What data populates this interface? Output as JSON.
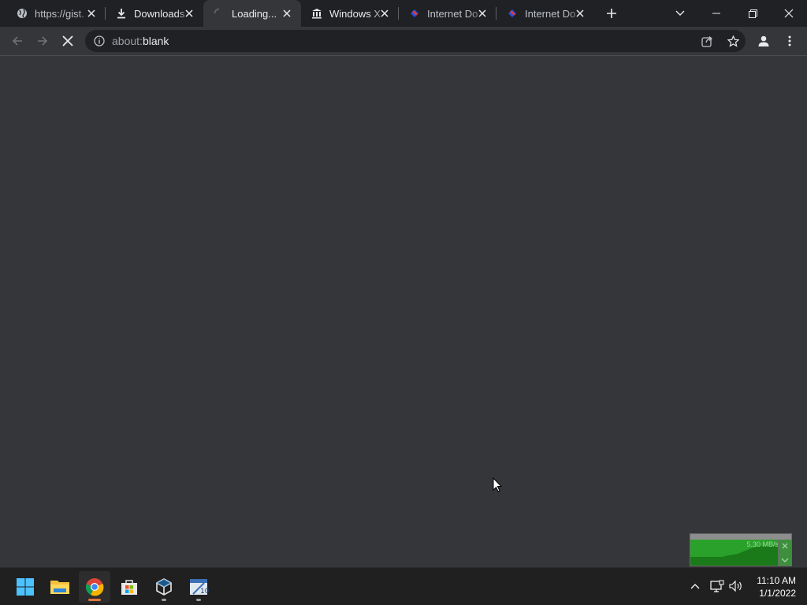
{
  "tabs": [
    {
      "label": "https://gist.",
      "favicon": "globe-icon",
      "active": false
    },
    {
      "label": "Downloads",
      "favicon": "download-icon",
      "active": false
    },
    {
      "label": "Loading...",
      "favicon": "loading-spinner-icon",
      "active": true
    },
    {
      "label": "Windows X",
      "favicon": "archive-building-icon",
      "active": false
    },
    {
      "label": "Internet Do",
      "favicon": "idm-icon",
      "active": false
    },
    {
      "label": "Internet Do",
      "favicon": "idm-icon",
      "active": false
    }
  ],
  "toolbar": {
    "url_scheme": "about:",
    "url_rest": "blank"
  },
  "speed_widget": {
    "speed": "5.30 MB/s"
  },
  "taskbar": {
    "apps": [
      "start-button",
      "file-explorer",
      "chrome",
      "microsoft-store",
      "virtualbox",
      "calendar-10"
    ]
  },
  "clock": {
    "time": "11:10 AM",
    "date": "1/1/2022"
  },
  "colors": {
    "tabstrip": "#202124",
    "page_bg": "#35363a",
    "omnibox": "#202124",
    "taskbar": "#202020",
    "accent": "#e0773a"
  }
}
